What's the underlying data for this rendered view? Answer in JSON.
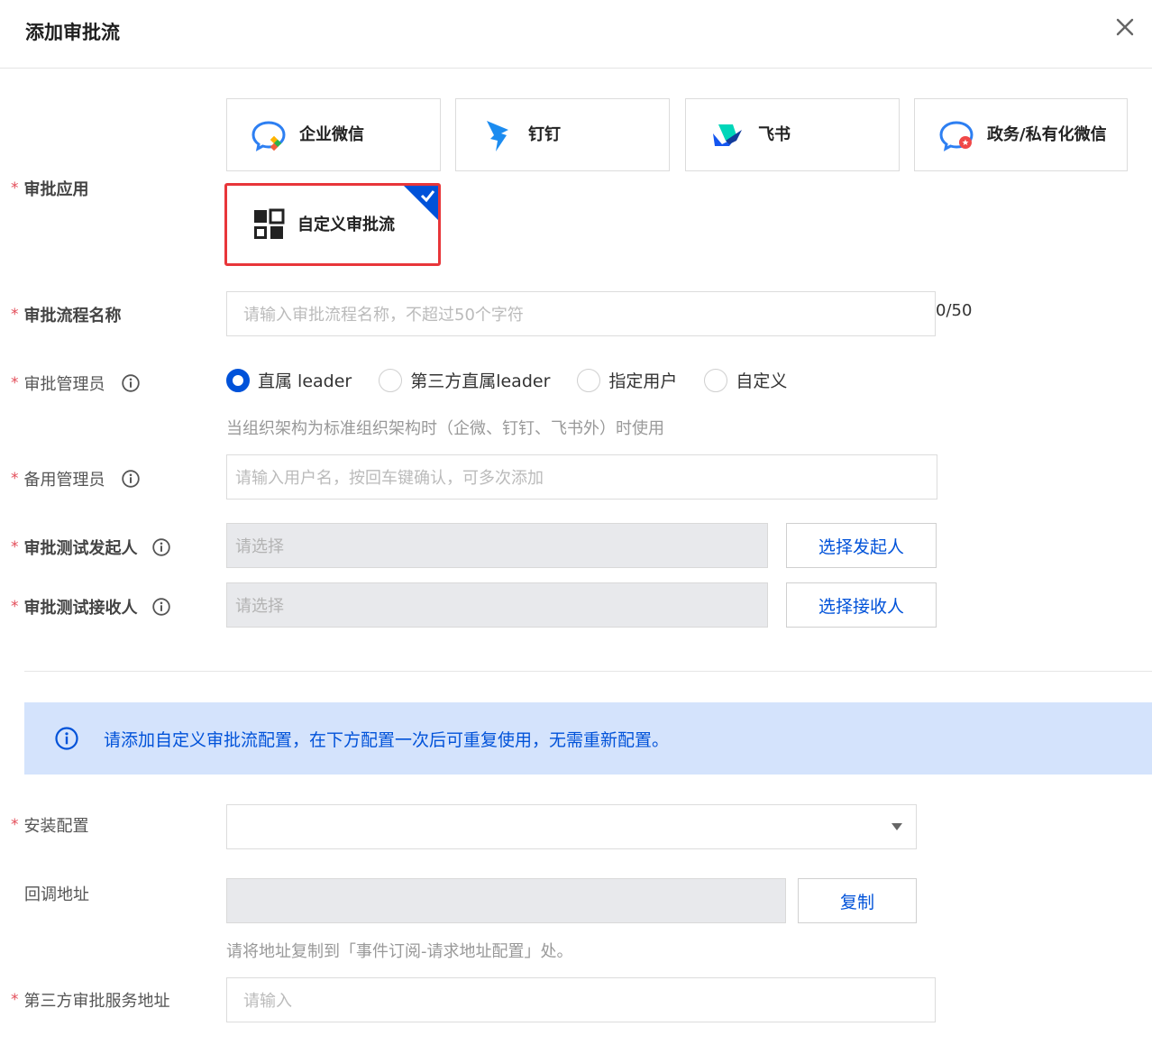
{
  "dialog": {
    "title": "添加审批流"
  },
  "approval_app": {
    "label": "审批应用",
    "options": [
      {
        "name": "企业微信",
        "icon": "wecom-icon"
      },
      {
        "name": "钉钉",
        "icon": "dingtalk-icon"
      },
      {
        "name": "飞书",
        "icon": "feishu-icon"
      },
      {
        "name": "政务/私有化微信",
        "icon": "gov-wechat-icon"
      },
      {
        "name": "自定义审批流",
        "icon": "custom-grid-icon",
        "selected": true
      }
    ]
  },
  "flow_name": {
    "label": "审批流程名称",
    "placeholder": "请输入审批流程名称，不超过50个字符",
    "counter": "0/50"
  },
  "admin": {
    "label": "审批管理员",
    "options": [
      {
        "label": "直属 leader",
        "checked": true
      },
      {
        "label": "第三方直属leader",
        "checked": false
      },
      {
        "label": "指定用户",
        "checked": false
      },
      {
        "label": "自定义",
        "checked": false
      }
    ],
    "hint": "当组织架构为标准组织架构时（企微、钉钉、飞书外）时使用"
  },
  "backup_admin": {
    "label": "备用管理员",
    "placeholder": "请输入用户名，按回车键确认，可多次添加"
  },
  "test_initiator": {
    "label": "审批测试发起人",
    "placeholder": "请选择",
    "button": "选择发起人"
  },
  "test_receiver": {
    "label": "审批测试接收人",
    "placeholder": "请选择",
    "button": "选择接收人"
  },
  "notice": {
    "text": "请添加自定义审批流配置，在下方配置一次后可重复使用，无需重新配置。"
  },
  "install_config": {
    "label": "安装配置",
    "value": ""
  },
  "callback": {
    "label": "回调地址",
    "value": "",
    "button": "复制",
    "hint": "请将地址复制到「事件订阅-请求地址配置」处。"
  },
  "third_party": {
    "label": "第三方审批服务地址",
    "placeholder": "请输入"
  },
  "colors": {
    "primary": "#0052d9",
    "required": "#e34d59",
    "selected_border": "#e8363a",
    "alert_bg": "#d4e3fc"
  }
}
